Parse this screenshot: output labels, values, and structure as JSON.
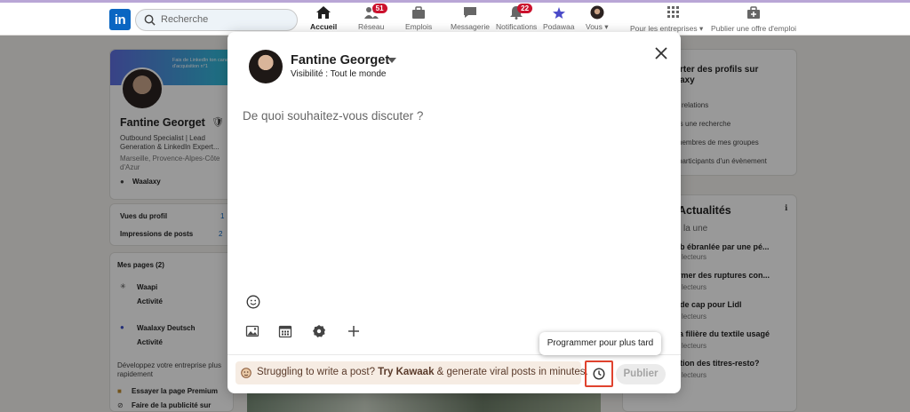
{
  "nav": {
    "logo_text": "in",
    "search_placeholder": "Recherche",
    "items": [
      {
        "label": "Accueil",
        "icon": "home-icon",
        "badge": ""
      },
      {
        "label": "Réseau",
        "icon": "network-icon",
        "badge": "51"
      },
      {
        "label": "Emplois",
        "icon": "briefcase-icon",
        "badge": ""
      },
      {
        "label": "Messagerie",
        "icon": "message-icon",
        "badge": ""
      },
      {
        "label": "Notifications",
        "icon": "bell-icon",
        "badge": "22"
      },
      {
        "label": "Podawaa",
        "icon": "podawaa-icon",
        "badge": ""
      },
      {
        "label": "Vous",
        "icon": "avatar-icon",
        "badge": ""
      }
    ],
    "business_label": "Pour les entreprises",
    "publish_job_label": "Publier une offre d'emploi"
  },
  "background": {
    "profile": {
      "banner_text_1": "Fais de LinkedIn ton canal",
      "banner_text_2": "d'acquisition n°1",
      "name": "Fantine Georget",
      "headline_1": "Outbound Specialist | Lead",
      "headline_2": "Generation & LinkedIn Expert...",
      "location_1": "Marseille, Provence-Alpes-Côte",
      "location_2": "d'Azur",
      "company": "Waalaxy"
    },
    "stats": [
      {
        "label": "Vues du profil",
        "value": "1"
      },
      {
        "label": "Impressions de posts",
        "value": "2"
      }
    ],
    "pages_title": "Mes pages (2)",
    "pages": [
      {
        "name": "Waapi",
        "status": "Activité"
      },
      {
        "name": "Waalaxy Deutsch",
        "status": "Activité"
      }
    ],
    "grow_text_1": "Développez votre entreprise plus",
    "grow_text_2": "rapidement",
    "premium_link": "Essayer la page Premium",
    "ads_link": "Faire de la publicité sur",
    "right_card": {
      "title_1": "rter des profils sur",
      "title_2": "axy",
      "items": [
        "relations",
        "is une recherche",
        "nembres de mes groupes",
        "participants d'un évènement"
      ]
    },
    "news": {
      "title": "Actualités",
      "subtitle": "la une",
      "items": [
        {
          "headline": "b ébranlée par une pé...",
          "meta": "lecteurs"
        },
        {
          "headline": "rmer des ruptures con...",
          "meta": "lecteurs"
        },
        {
          "headline": "de cap pour Lidl",
          "meta": "lecteurs"
        },
        {
          "headline": "a filière du textile usagé",
          "meta": "lecteurs"
        },
        {
          "headline": "tion des titres-resto?",
          "meta": "lecteurs"
        }
      ]
    }
  },
  "modal": {
    "author_name": "Fantine Georget",
    "visibility": "Visibilité : Tout le monde",
    "placeholder": "De quoi souhaitez-vous discuter ?",
    "promo_text": "Struggling to write a post?",
    "promo_link": "Try Kawaak",
    "promo_tail": "& generate viral posts in minutes.",
    "publish_label": "Publier",
    "schedule_tooltip": "Programmer pour plus tard"
  }
}
